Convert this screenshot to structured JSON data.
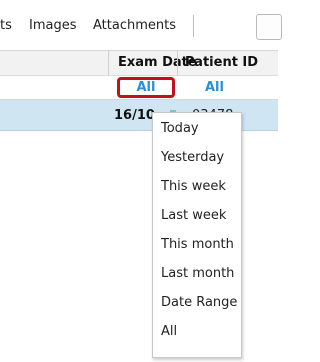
{
  "tabs": {
    "items": [
      {
        "label": "ts"
      },
      {
        "label": "Images"
      },
      {
        "label": "Attachments"
      }
    ]
  },
  "table": {
    "columns": [
      {
        "label": "Exam Date",
        "filter": "All"
      },
      {
        "label": "Patient ID",
        "filter": "All"
      }
    ],
    "rows": [
      {
        "exam_date": "16/10",
        "patient_id": "03478"
      }
    ]
  },
  "dropdown": {
    "options": [
      "Today",
      "Yesterday",
      "This week",
      "Last week",
      "This month",
      "Last month",
      "Date Range",
      "All"
    ]
  },
  "colors": {
    "filter_highlight_border": "#c0121c",
    "filter_text": "#2a8fd6",
    "selected_row": "#cfe5f2"
  }
}
